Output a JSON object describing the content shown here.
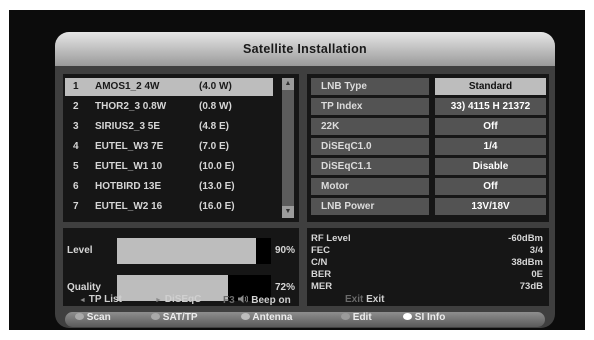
{
  "title": "Satellite Installation",
  "satellites": [
    {
      "num": "1",
      "name": "AMOS1_2 4W",
      "pos": "(4.0 W)"
    },
    {
      "num": "2",
      "name": "THOR2_3 0.8W",
      "pos": "(0.8 W)"
    },
    {
      "num": "3",
      "name": "SIRIUS2_3 5E",
      "pos": "(4.8 E)"
    },
    {
      "num": "4",
      "name": "EUTEL_W3 7E",
      "pos": "(7.0 E)"
    },
    {
      "num": "5",
      "name": "EUTEL_W1 10",
      "pos": "(10.0 E)"
    },
    {
      "num": "6",
      "name": "HOTBIRD 13E",
      "pos": "(13.0 E)"
    },
    {
      "num": "7",
      "name": "EUTEL_W2 16",
      "pos": "(16.0 E)"
    }
  ],
  "params": [
    {
      "label": "LNB Type",
      "value": "Standard"
    },
    {
      "label": "TP Index",
      "value": "33) 4115 H 21372"
    },
    {
      "label": "22K",
      "value": "Off"
    },
    {
      "label": "DiSEqC1.0",
      "value": "1/4"
    },
    {
      "label": "DiSEqC1.1",
      "value": "Disable"
    },
    {
      "label": "Motor",
      "value": "Off"
    },
    {
      "label": "LNB Power",
      "value": "13V/18V"
    }
  ],
  "signal": {
    "level_label": "Level",
    "level_pct": "90%",
    "level_value": 0.9,
    "quality_label": "Quality",
    "quality_pct": "72%",
    "quality_value": 0.72
  },
  "rf": [
    {
      "k": "RF Level",
      "v": "-60dBm"
    },
    {
      "k": "FEC",
      "v": "3/4"
    },
    {
      "k": "C/N",
      "v": "38dBm"
    },
    {
      "k": "BER",
      "v": "0E"
    },
    {
      "k": "MER",
      "v": "73dB"
    }
  ],
  "hints": {
    "tp_list_icon": "◄",
    "tp_list": "TP List",
    "diseqc_icon": "►",
    "diseqc": "DiSEqC",
    "f3_key": "F3",
    "beep_icon": "speaker-icon",
    "beep": "Beep on",
    "exit_key": "Exit",
    "exit": "Exit"
  },
  "footer": {
    "scan": "Scan",
    "sat_tp": "SAT/TP",
    "antenna": "Antenna",
    "edit": "Edit",
    "si_info": "SI Info"
  },
  "colors": {
    "panel": "#3f3f3f",
    "selected": "#bdbdbd",
    "text": "#d6d6d6"
  }
}
